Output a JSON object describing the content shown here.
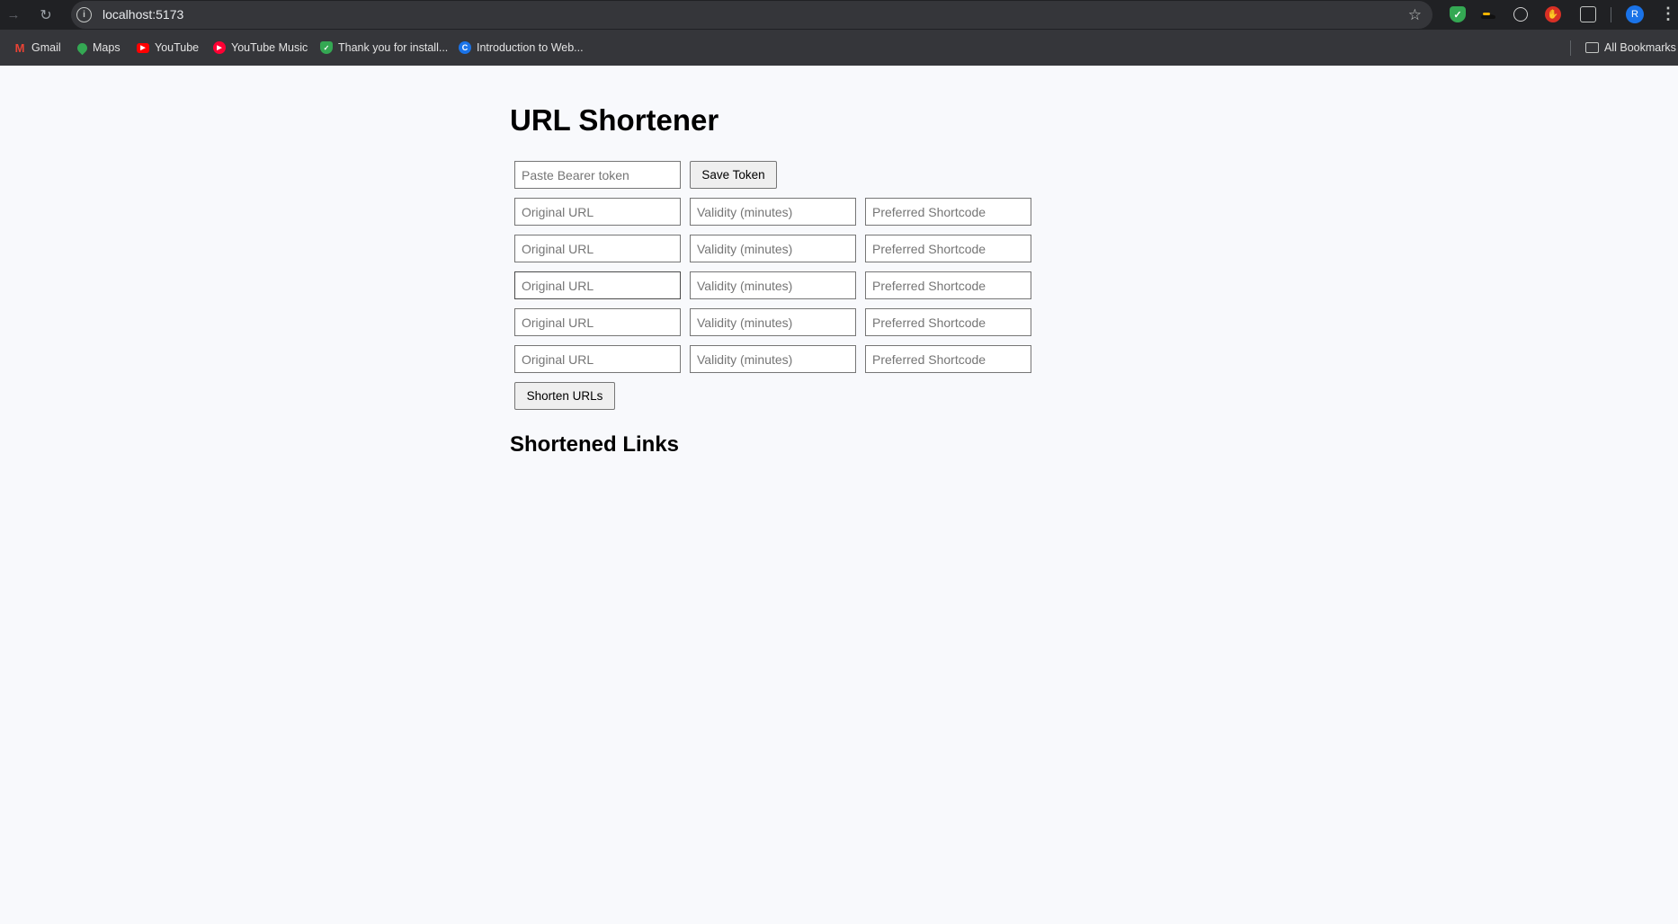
{
  "browser": {
    "url": "localhost:5173",
    "profile_initial": "R",
    "bookmarks": [
      {
        "label": "Gmail",
        "icon": "gmail-icon"
      },
      {
        "label": "Maps",
        "icon": "maps-icon"
      },
      {
        "label": "YouTube",
        "icon": "youtube-icon"
      },
      {
        "label": "YouTube Music",
        "icon": "youtube-music-icon"
      },
      {
        "label": "Thank you for install...",
        "icon": "shield-icon"
      },
      {
        "label": "Introduction to Web...",
        "icon": "c-logo-icon"
      }
    ],
    "all_bookmarks_label": "All Bookmarks"
  },
  "page": {
    "title": "URL Shortener",
    "token": {
      "placeholder": "Paste Bearer token",
      "value": "",
      "save_label": "Save Token"
    },
    "url_rows": [
      {
        "url_placeholder": "Original URL",
        "validity_placeholder": "Validity (minutes)",
        "shortcode_placeholder": "Preferred Shortcode"
      },
      {
        "url_placeholder": "Original URL",
        "validity_placeholder": "Validity (minutes)",
        "shortcode_placeholder": "Preferred Shortcode"
      },
      {
        "url_placeholder": "Original URL",
        "validity_placeholder": "Validity (minutes)",
        "shortcode_placeholder": "Preferred Shortcode"
      },
      {
        "url_placeholder": "Original URL",
        "validity_placeholder": "Validity (minutes)",
        "shortcode_placeholder": "Preferred Shortcode"
      },
      {
        "url_placeholder": "Original URL",
        "validity_placeholder": "Validity (minutes)",
        "shortcode_placeholder": "Preferred Shortcode"
      }
    ],
    "shorten_label": "Shorten URLs",
    "results_heading": "Shortened Links"
  }
}
